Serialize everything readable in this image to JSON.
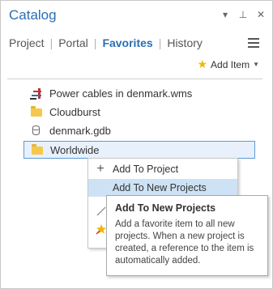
{
  "window": {
    "title": "Catalog",
    "controls": [
      "chevron-down-icon",
      "pin-icon",
      "close-icon"
    ]
  },
  "tabs": [
    {
      "label": "Project",
      "active": false
    },
    {
      "label": "Portal",
      "active": false
    },
    {
      "label": "Favorites",
      "active": true
    },
    {
      "label": "History",
      "active": false
    }
  ],
  "toolbar": {
    "add_item_label": "Add Item"
  },
  "favorites": [
    {
      "label": "Power cables in denmark.wms",
      "icon": "wms-icon",
      "selected": false
    },
    {
      "label": "Cloudburst",
      "icon": "folder-icon",
      "selected": false
    },
    {
      "label": "denmark.gdb",
      "icon": "database-icon",
      "selected": false
    },
    {
      "label": "Worldwide",
      "icon": "folder-icon",
      "selected": true
    }
  ],
  "context_menu": {
    "items": [
      {
        "label": "Add To Project",
        "icon": "plus-icon"
      },
      {
        "label": "Add To New Projects",
        "icon": "",
        "hover": true
      }
    ]
  },
  "tooltip": {
    "title": "Add To New Projects",
    "body": "Add a favorite item to all new projects. When a new project is created, a reference to the item is automatically added."
  },
  "colors": {
    "accent": "#2a6fb3",
    "selection_border": "#5a9bd5",
    "hover_fill": "#cde3f5",
    "folder": "#f4c84c",
    "star": "#f2b705"
  }
}
